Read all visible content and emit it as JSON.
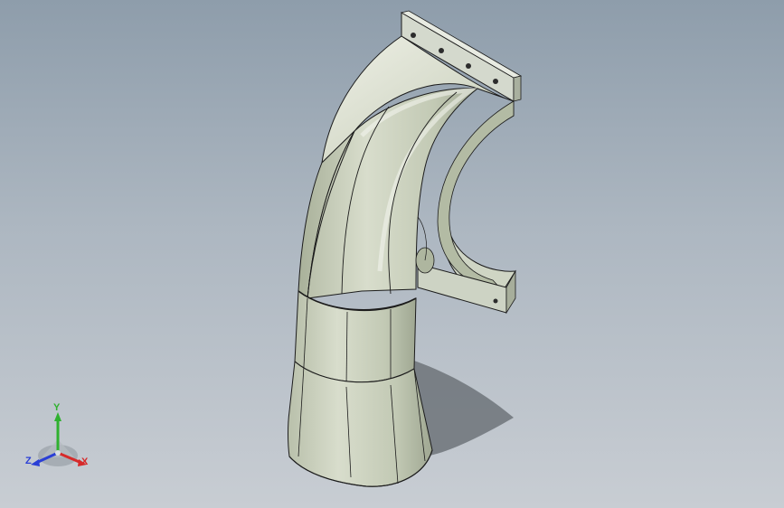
{
  "viewport": {
    "background_top": "#8e9dab",
    "background_bottom": "#c8cdd3"
  },
  "model": {
    "shell_color": "#c9d0bd",
    "edge_color": "#1c1c1c",
    "flange_color": "#d3d8cc"
  },
  "triad": {
    "y_label": "Y",
    "x_label": "X",
    "z_label": "Z",
    "y_color": "#2fb12f",
    "x_color": "#d62a2a",
    "z_color": "#2a3fd6"
  }
}
